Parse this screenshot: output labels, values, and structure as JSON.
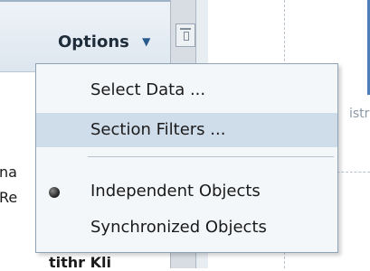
{
  "toolbar": {
    "options_label": "Options",
    "options_caret": "▼"
  },
  "background_text": {
    "line1": "na",
    "line2": "Re",
    "line3": "tithr Kli",
    "right_partial": "istr"
  },
  "options_menu": {
    "items": [
      {
        "label": "Select Data ...",
        "selected": false
      },
      {
        "label": "Section Filters ...",
        "selected": false,
        "highlighted": true
      },
      {
        "label": "Independent Objects",
        "selected": true
      },
      {
        "label": "Synchronized Objects",
        "selected": false
      }
    ]
  },
  "colors": {
    "menu_highlight": "#cfdcea",
    "accent_blue": "#4f7fb8"
  },
  "icons": {
    "options_caret": "chevron-down-icon",
    "radio_selected": "radio-dot-icon",
    "panel_icon": "panel-layout-icon"
  }
}
